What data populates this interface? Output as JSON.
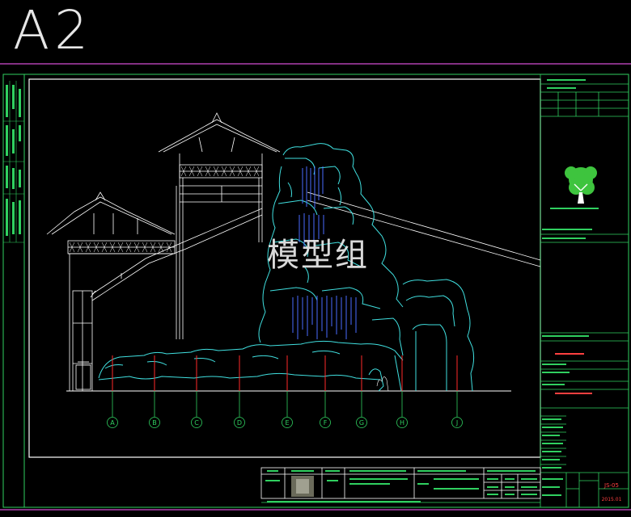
{
  "sheet": {
    "label": "A2",
    "watermark": "模型组",
    "sheet_number": "JS-05",
    "date": "2015.01"
  },
  "grid_axes": [
    "A",
    "B",
    "C",
    "D",
    "E",
    "F",
    "G",
    "H",
    "J"
  ],
  "colors": {
    "background": "#000000",
    "frame": "#ffffff",
    "magenta_line": "#b040b0",
    "border_green": "#30d060",
    "rock_cyan": "#40e0e0",
    "waterfall_blue": "#4a6cff",
    "axis_red": "#ff2a2a",
    "tree_green": "#3ec43e",
    "annotation_red": "#ff4040"
  }
}
